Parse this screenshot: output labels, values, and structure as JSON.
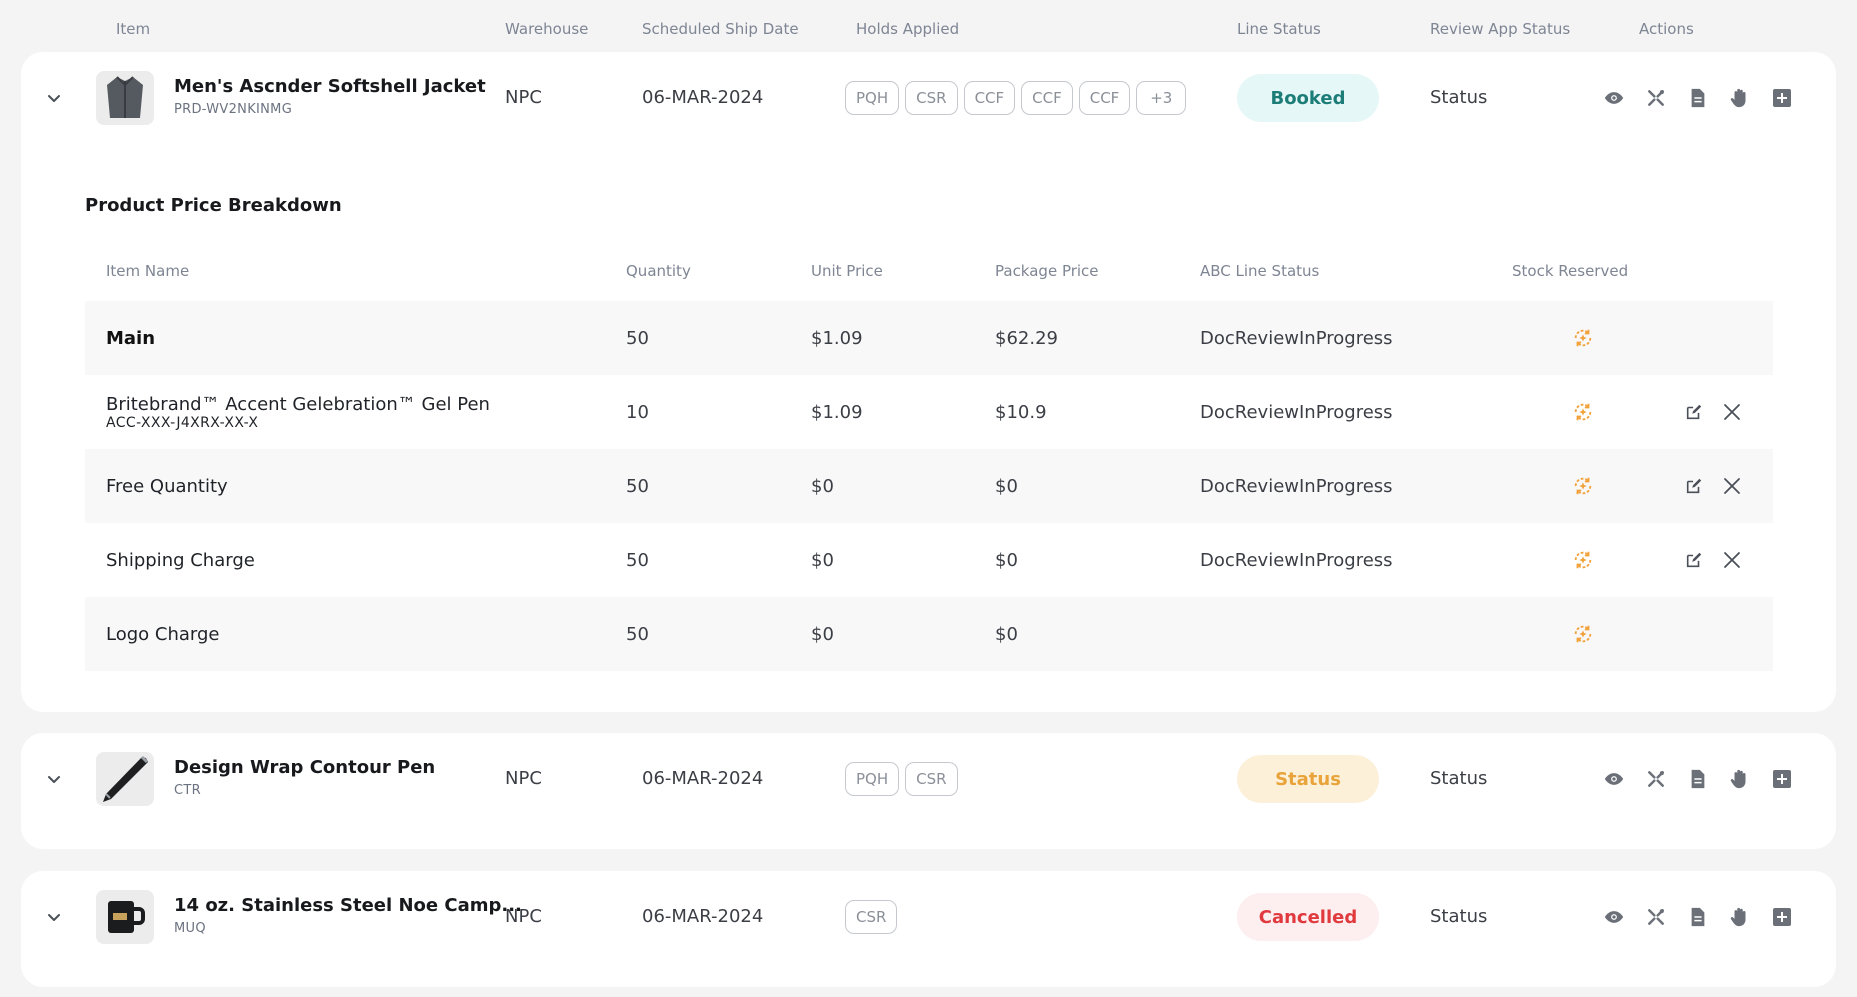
{
  "columns": {
    "item": "Item",
    "warehouse": "Warehouse",
    "ship_date": "Scheduled Ship Date",
    "holds": "Holds Applied",
    "line_status": "Line Status",
    "review_status": "Review App Status",
    "actions": "Actions"
  },
  "colors": {
    "booked_bg": "#e5f7f6",
    "booked_fg": "#1c7d78",
    "status_bg": "#fdf0d9",
    "status_fg": "#e8a33a",
    "cancelled_bg": "#fdeeef",
    "cancelled_fg": "#e0393e",
    "stock_icon": "#f2a23a"
  },
  "orders": [
    {
      "name": "Men's Ascnder Softshell Jacket",
      "sku": "PRD-WV2NKINMG",
      "image": "jacket",
      "warehouse": "NPC",
      "ship_date": "06-MAR-2024",
      "holds": [
        "PQH",
        "CSR",
        "CCF",
        "CCF",
        "CCF",
        "+3"
      ],
      "line_status": "Booked",
      "line_status_style": "booked",
      "review_status": "Status",
      "expanded": true
    },
    {
      "name": "Design Wrap Contour Pen",
      "sku": "CTR",
      "image": "pen",
      "warehouse": "NPC",
      "ship_date": "06-MAR-2024",
      "holds": [
        "PQH",
        "CSR"
      ],
      "line_status": "Status",
      "line_status_style": "status",
      "review_status": "Status",
      "expanded": false
    },
    {
      "name": "14 oz. Stainless Steel Noe Camp...",
      "sku": "MUQ",
      "image": "mug",
      "warehouse": "NPC",
      "ship_date": "06-MAR-2024",
      "holds": [
        "CSR"
      ],
      "line_status": "Cancelled",
      "line_status_style": "cancelled",
      "review_status": "Status",
      "expanded": false
    }
  ],
  "breakdown": {
    "title": "Product Price Breakdown",
    "columns": {
      "item_name": "Item Name",
      "quantity": "Quantity",
      "unit_price": "Unit Price",
      "package_price": "Package Price",
      "abc_status": "ABC Line Status",
      "stock_reserved": "Stock Reserved"
    },
    "rows": [
      {
        "name": "Main",
        "sku": "",
        "quantity": "50",
        "unit_price": "$1.09",
        "package_price": "$62.29",
        "abc_status": "DocReviewInProgress",
        "editable": false,
        "bold": true
      },
      {
        "name": "Britebrand™ Accent Gelebration™ Gel Pen",
        "sku": "ACC-XXX-J4XRX-XX-X",
        "quantity": "10",
        "unit_price": "$1.09",
        "package_price": "$10.9",
        "abc_status": "DocReviewInProgress",
        "editable": true,
        "bold": false
      },
      {
        "name": "Free Quantity",
        "sku": "",
        "quantity": "50",
        "unit_price": "$0",
        "package_price": "$0",
        "abc_status": "DocReviewInProgress",
        "editable": true,
        "bold": false
      },
      {
        "name": "Shipping Charge",
        "sku": "",
        "quantity": "50",
        "unit_price": "$0",
        "package_price": "$0",
        "abc_status": "DocReviewInProgress",
        "editable": true,
        "bold": false
      },
      {
        "name": "Logo Charge",
        "sku": "",
        "quantity": "50",
        "unit_price": "$0",
        "package_price": "$0",
        "abc_status": "",
        "editable": false,
        "bold": false
      }
    ]
  }
}
